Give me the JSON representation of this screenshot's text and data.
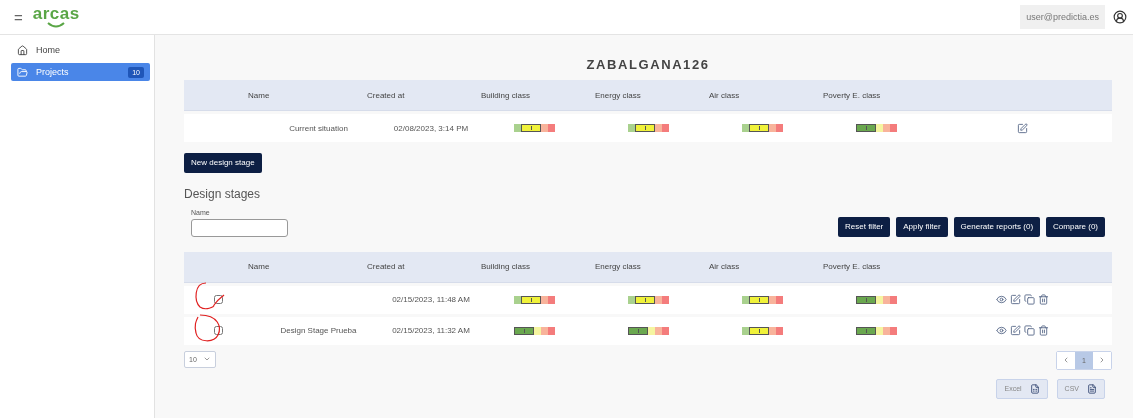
{
  "header": {
    "menu": "=",
    "logo": "arcas",
    "user": "user@predictia.es"
  },
  "sidebar": {
    "items": [
      {
        "label": "Home",
        "selected": false
      },
      {
        "label": "Projects",
        "selected": true,
        "badge": "10"
      }
    ]
  },
  "project": {
    "title": "ZABALGANA126",
    "columns": [
      "Name",
      "Created at",
      "Building class",
      "Energy class",
      "Air class",
      "Poverty E. class"
    ],
    "rows": [
      {
        "name": "Current situation",
        "created": "02/08/2023, 3:14 PM",
        "classes": [
          {
            "segments": [
              {
                "color": "#a9d18e",
                "selected": false
              },
              {
                "color": "#f0f23a",
                "selected": true
              },
              {
                "color": "#f8b39b",
                "selected": false
              },
              {
                "color": "#f47c7c",
                "selected": false
              }
            ]
          },
          {
            "segments": [
              {
                "color": "#a9d18e",
                "selected": false
              },
              {
                "color": "#f0f23a",
                "selected": true
              },
              {
                "color": "#f8b39b",
                "selected": false
              },
              {
                "color": "#f47c7c",
                "selected": false
              }
            ]
          },
          {
            "segments": [
              {
                "color": "#a9d18e",
                "selected": false
              },
              {
                "color": "#f0f23a",
                "selected": true
              },
              {
                "color": "#f8b39b",
                "selected": false
              },
              {
                "color": "#f47c7c",
                "selected": false
              }
            ]
          },
          {
            "segments": [
              {
                "color": "#6aa84f",
                "selected": true
              },
              {
                "color": "#f5f5a0",
                "selected": false
              },
              {
                "color": "#f8b39b",
                "selected": false
              },
              {
                "color": "#f47c7c",
                "selected": false
              }
            ]
          }
        ]
      }
    ]
  },
  "new_stage_button": "New design stage",
  "design_stages": {
    "heading": "Design stages",
    "filter": {
      "label": "Name"
    },
    "buttons": [
      "Reset filter",
      "Apply filter",
      "Generate reports (0)",
      "Compare (0)"
    ],
    "columns": [
      "Name",
      "Created at",
      "Building class",
      "Energy class",
      "Air class",
      "Poverty E. class"
    ],
    "rows": [
      {
        "checked": false,
        "name": "",
        "created": "02/15/2023, 11:48 AM",
        "classes": [
          {
            "segments": [
              {
                "color": "#a9d18e",
                "selected": false
              },
              {
                "color": "#f0f23a",
                "selected": true
              },
              {
                "color": "#f8b39b",
                "selected": false
              },
              {
                "color": "#f47c7c",
                "selected": false
              }
            ]
          },
          {
            "segments": [
              {
                "color": "#a9d18e",
                "selected": false
              },
              {
                "color": "#f0f23a",
                "selected": true
              },
              {
                "color": "#f8b39b",
                "selected": false
              },
              {
                "color": "#f47c7c",
                "selected": false
              }
            ]
          },
          {
            "segments": [
              {
                "color": "#a9d18e",
                "selected": false
              },
              {
                "color": "#f0f23a",
                "selected": true
              },
              {
                "color": "#f8b39b",
                "selected": false
              },
              {
                "color": "#f47c7c",
                "selected": false
              }
            ]
          },
          {
            "segments": [
              {
                "color": "#6aa84f",
                "selected": true
              },
              {
                "color": "#f5f5a0",
                "selected": false
              },
              {
                "color": "#f8b39b",
                "selected": false
              },
              {
                "color": "#f47c7c",
                "selected": false
              }
            ]
          }
        ]
      },
      {
        "checked": false,
        "name": "Design Stage Prueba",
        "created": "02/15/2023, 11:32 AM",
        "classes": [
          {
            "segments": [
              {
                "color": "#6aa84f",
                "selected": true
              },
              {
                "color": "#f5f5a0",
                "selected": false
              },
              {
                "color": "#f8b39b",
                "selected": false
              },
              {
                "color": "#f47c7c",
                "selected": false
              }
            ]
          },
          {
            "segments": [
              {
                "color": "#6aa84f",
                "selected": true
              },
              {
                "color": "#f5f5a0",
                "selected": false
              },
              {
                "color": "#f8b39b",
                "selected": false
              },
              {
                "color": "#f47c7c",
                "selected": false
              }
            ]
          },
          {
            "segments": [
              {
                "color": "#a9d18e",
                "selected": false
              },
              {
                "color": "#f0f23a",
                "selected": true
              },
              {
                "color": "#f8b39b",
                "selected": false
              },
              {
                "color": "#f47c7c",
                "selected": false
              }
            ]
          },
          {
            "segments": [
              {
                "color": "#6aa84f",
                "selected": true
              },
              {
                "color": "#f5f5a0",
                "selected": false
              },
              {
                "color": "#f8b39b",
                "selected": false
              },
              {
                "color": "#f47c7c",
                "selected": false
              }
            ]
          }
        ]
      }
    ],
    "page_size": "10",
    "pages": [
      {
        "label": "1",
        "selected": true
      }
    ],
    "exports": [
      "Excel",
      "CSV"
    ]
  }
}
